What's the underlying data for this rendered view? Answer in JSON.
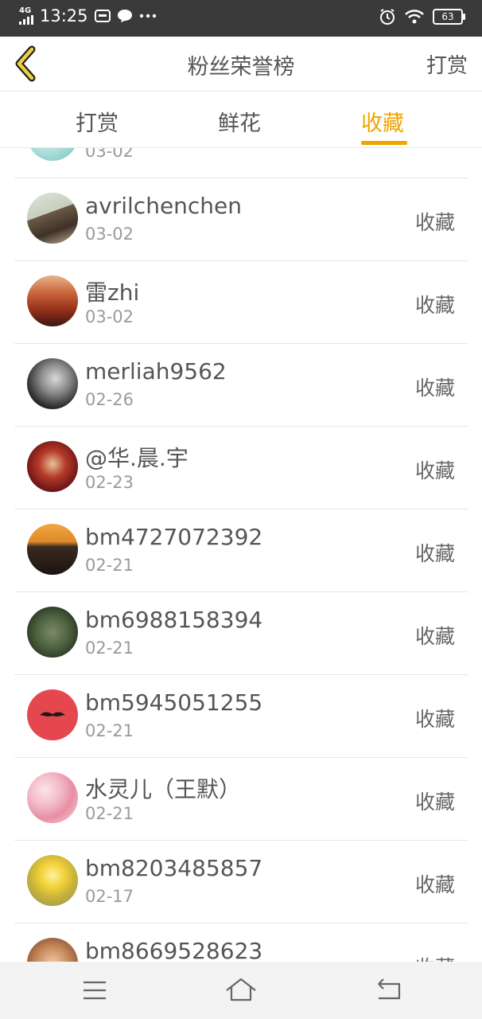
{
  "status_bar": {
    "network": "4G",
    "time": "13:25",
    "battery": "63",
    "icons": [
      "signal-icon",
      "message-icon",
      "chat-icon",
      "more-icon",
      "alarm-icon",
      "wifi-icon",
      "battery-icon"
    ]
  },
  "nav": {
    "title": "粉丝荣誉榜",
    "right_label": "打赏",
    "back_icon": "chevron-left-icon"
  },
  "tabs": [
    {
      "label": "打赏",
      "active": false
    },
    {
      "label": "鲜花",
      "active": false
    },
    {
      "label": "收藏",
      "active": true
    }
  ],
  "colors": {
    "accent": "#f0a500",
    "status_bar_bg": "#3a3a3a",
    "divider": "#e6e6e6"
  },
  "list": {
    "partial_top": {
      "date": "03-02"
    },
    "items": [
      {
        "name": "avrilchenchen",
        "date": "03-02",
        "action": "收藏"
      },
      {
        "name": "雷zhi",
        "date": "03-02",
        "action": "收藏"
      },
      {
        "name": "merliah9562",
        "date": "02-26",
        "action": "收藏"
      },
      {
        "name": "@华.晨.宇",
        "date": "02-23",
        "action": "收藏"
      },
      {
        "name": "bm4727072392",
        "date": "02-21",
        "action": "收藏"
      },
      {
        "name": "bm6988158394",
        "date": "02-21",
        "action": "收藏"
      },
      {
        "name": "bm5945051255",
        "date": "02-21",
        "action": "收藏"
      },
      {
        "name": "水灵儿（王默）",
        "date": "02-21",
        "action": "收藏"
      },
      {
        "name": "bm8203485857",
        "date": "02-17",
        "action": "收藏"
      },
      {
        "name": "bm8669528623",
        "date": "",
        "action": "收藏"
      }
    ]
  },
  "bottom_nav": {
    "icons": [
      "menu-icon",
      "home-icon",
      "back-icon"
    ]
  }
}
